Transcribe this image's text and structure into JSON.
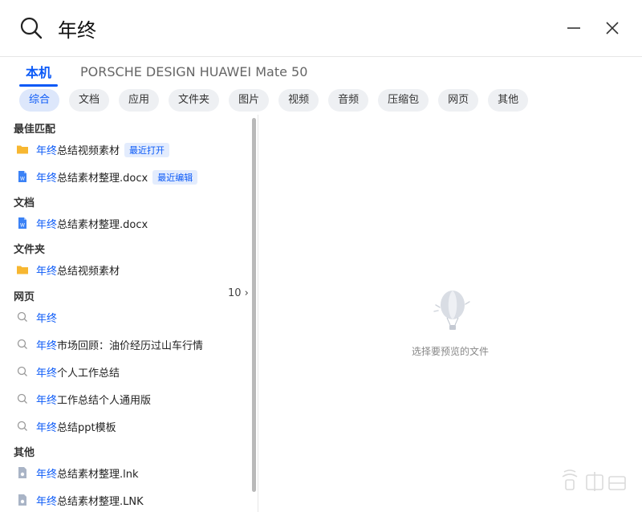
{
  "search": {
    "query": "年终"
  },
  "scope_tabs": [
    {
      "label": "本机",
      "active": true
    },
    {
      "label": "PORSCHE DESIGN HUAWEI Mate 50",
      "active": false
    }
  ],
  "filters": [
    {
      "label": "综合",
      "active": true
    },
    {
      "label": "文档"
    },
    {
      "label": "应用"
    },
    {
      "label": "文件夹"
    },
    {
      "label": "图片"
    },
    {
      "label": "视频"
    },
    {
      "label": "音频"
    },
    {
      "label": "压缩包"
    },
    {
      "label": "网页"
    },
    {
      "label": "其他"
    }
  ],
  "sections": {
    "best": {
      "title": "最佳匹配",
      "items": [
        {
          "highlight": "年终",
          "rest": "总结视频素材",
          "badge": "最近打开",
          "icon": "folder-icon"
        },
        {
          "highlight": "年终",
          "rest": "总结素材整理.docx",
          "badge": "最近编辑",
          "icon": "word-doc-icon"
        }
      ]
    },
    "docs": {
      "title": "文档",
      "items": [
        {
          "highlight": "年终",
          "rest": "总结素材整理.docx",
          "icon": "word-doc-icon"
        }
      ]
    },
    "folders": {
      "title": "文件夹",
      "items": [
        {
          "highlight": "年终",
          "rest": "总结视频素材",
          "icon": "folder-icon"
        }
      ]
    },
    "web": {
      "title": "网页",
      "more": "10 ›",
      "items": [
        {
          "highlight": "年终",
          "rest": "",
          "icon": "search-suggestion-icon"
        },
        {
          "highlight": "年终",
          "rest": "市场回顾：油价经历过山车行情",
          "icon": "search-suggestion-icon"
        },
        {
          "highlight": "年终",
          "rest": "个人工作总结",
          "icon": "search-suggestion-icon"
        },
        {
          "highlight": "年终",
          "rest": "工作总结个人通用版",
          "icon": "search-suggestion-icon"
        },
        {
          "highlight": "年终",
          "rest": "总结ppt模板",
          "icon": "search-suggestion-icon"
        }
      ]
    },
    "other": {
      "title": "其他",
      "items": [
        {
          "highlight": "年终",
          "rest": "总结素材整理.lnk",
          "icon": "shortcut-file-icon"
        },
        {
          "highlight": "年终",
          "rest": "总结素材整理.LNK",
          "icon": "shortcut-file-icon"
        }
      ]
    }
  },
  "preview": {
    "empty_text": "选择要预览的文件",
    "icon": "balloon-icon"
  },
  "colors": {
    "accent": "#0a59f7",
    "folder": "#f7b731",
    "doc": "#3b82f6"
  }
}
